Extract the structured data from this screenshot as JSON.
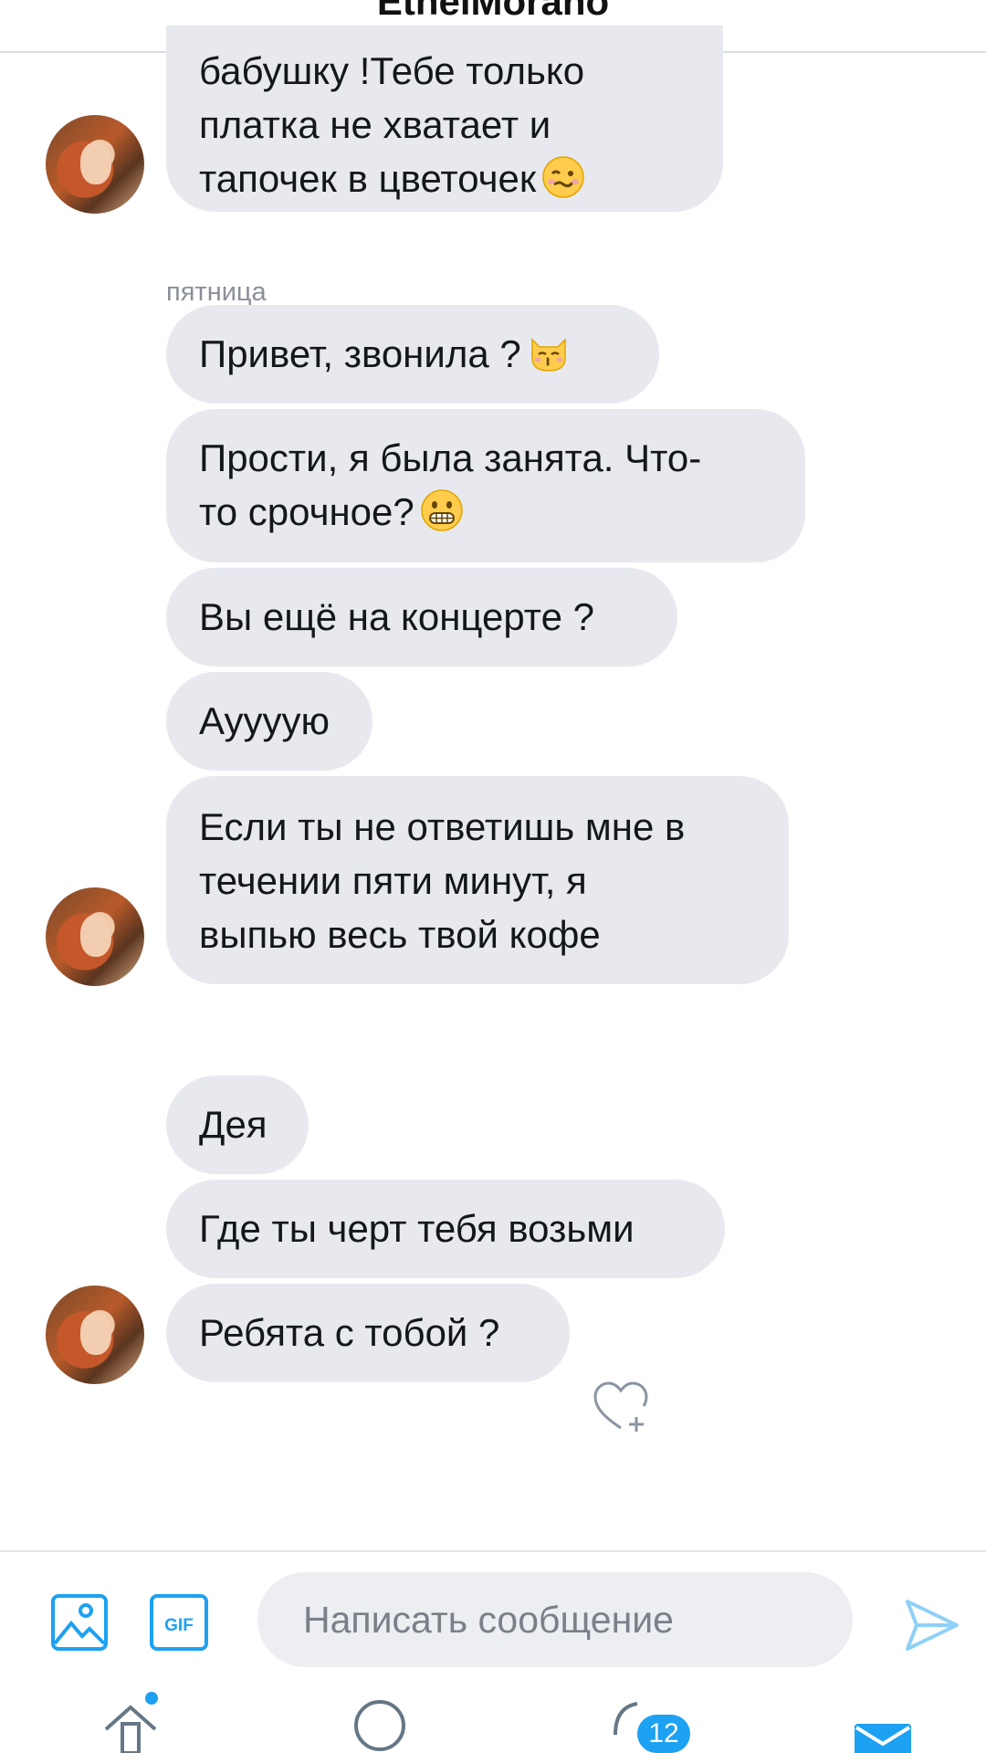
{
  "header": {
    "title": "EthelMorano"
  },
  "day_label": "пятница",
  "messages": [
    {
      "lines": [
        "бабушку !Тебе только",
        "платка не хватает и",
        "тапочек в цветочек"
      ],
      "emoji": "woozy-face"
    },
    {
      "lines": [
        "Привет, звонила ?"
      ],
      "emoji": "kissing-cat-face"
    },
    {
      "lines": [
        "Прости, я была занята. Что-",
        "то срочное?"
      ],
      "emoji": "grimacing-face"
    },
    {
      "lines": [
        "Вы ещё на концерте ?"
      ]
    },
    {
      "lines": [
        "Ауууую"
      ]
    },
    {
      "lines": [
        "Если ты не ответишь мне в",
        "течении пяти минут, я",
        "выпью весь твой кофе"
      ]
    },
    {
      "lines": [
        "Дея"
      ]
    },
    {
      "lines": [
        "Где ты черт тебя возьми"
      ]
    },
    {
      "lines": [
        "Ребята с тобой ?"
      ]
    }
  ],
  "composer": {
    "placeholder": "Написать сообщение",
    "gif_label": "GIF"
  },
  "tabbar": {
    "badge_count": "12"
  },
  "colors": {
    "accent": "#1da1f2",
    "bubble": "#e7e9ef"
  }
}
